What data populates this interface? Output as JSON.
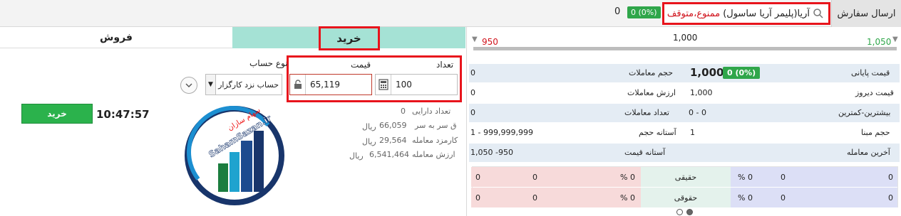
{
  "topbar": {
    "send_order_label": "ارسال سفارش",
    "symbol_name": "آریا(پلیمر آریا ساسول)",
    "symbol_status": "ممنوع،متوقف",
    "change_badge": "0 (0%)",
    "last_price": "0"
  },
  "tabs": {
    "buy": "خرید",
    "sell": "فروش"
  },
  "order_form": {
    "qty_label": "تعداد",
    "price_label": "قیمت",
    "account_type_label": "نوع حساب",
    "qty_value": "100",
    "price_value": "65,119",
    "account_type_value": "حساب نزد کارگزار",
    "submit_label": "خرید",
    "time": "10:47:57"
  },
  "summary": {
    "assets_label": "تعداد دارایی",
    "assets_value": "0",
    "breakeven_label": "ق سر به سر",
    "breakeven_value": "66,059",
    "breakeven_unit": "ریال",
    "fee_label": "کارمزد معامله",
    "fee_value": "29,564",
    "fee_unit": "ریال",
    "trade_value_label": "ارزش معامله",
    "trade_value_value": "6,541,464",
    "trade_value_unit": "ریال"
  },
  "logo": {
    "text_fa": "سهام سازان",
    "text_en": "SahamSazan.ir"
  },
  "range": {
    "low": "950",
    "mid": "1,000",
    "high": "1,050"
  },
  "stats": {
    "close_price_label": "قیمت پایانی",
    "close_price_value": "1,000",
    "close_change": "0 (0%)",
    "volume_label": "حجم معاملات",
    "volume_value": "0",
    "yesterday_label": "قیمت دیروز",
    "yesterday_value": "1,000",
    "value_label": "ارزش معاملات",
    "value_value": "0",
    "minmax_label": "بیشترین-کمترین",
    "minmax_value": "0 - 0",
    "count_label": "تعداد معاملات",
    "count_value": "0",
    "base_volume_label": "حجم مبنا",
    "base_volume_value": "1",
    "volume_threshold_label": "آستانه حجم",
    "volume_threshold_value": "1 - 999,999,999",
    "last_trade_label": "آخرین معامله",
    "price_threshold_label": "آستانه قیمت",
    "price_threshold_value": "1,050 -950"
  },
  "legal_table": {
    "row1_label": "حقیقی",
    "row2_label": "حقوقی",
    "zero": "0",
    "pct": "% 0"
  },
  "colors": {
    "buy_tab": "#a5e2d5",
    "green": "#2fa64a",
    "red_highlight": "#e8141c",
    "low_red": "#d0121b"
  }
}
